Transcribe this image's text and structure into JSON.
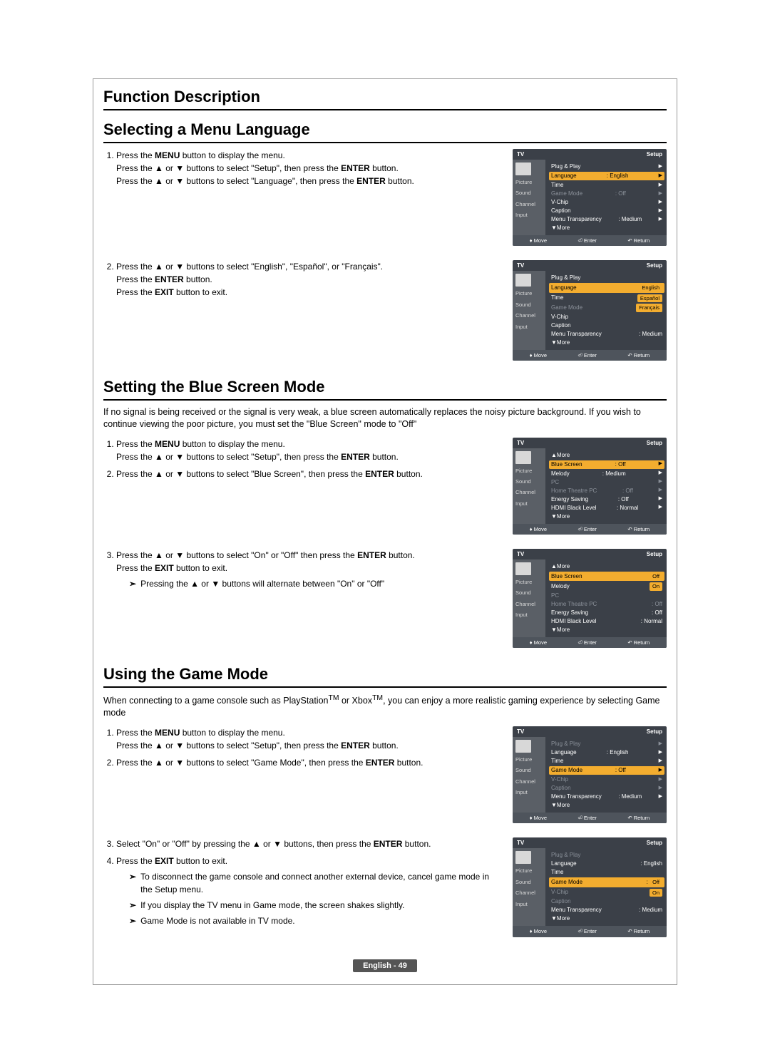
{
  "headings": {
    "function_desc": "Function Description",
    "select_lang": "Selecting a Menu Language",
    "blue_screen": "Setting the Blue Screen Mode",
    "game_mode": "Using the Game Mode"
  },
  "lang_section": {
    "step1_a": "Press the ",
    "step1_menu": "MENU",
    "step1_b": " button to display the menu.",
    "step1_c": "Press the ▲ or ▼ buttons to select \"Setup\", then press the ",
    "enter": "ENTER",
    "step1_d": " button.",
    "step1_e": "Press the ▲ or ▼ buttons to select \"Language\", then press the ",
    "step2_a": "Press the ▲ or ▼ buttons to select \"English\", \"Español\", or \"Français\".",
    "step2_b": "Press the ",
    "step2_c": " button.",
    "step2_d": "Press the ",
    "exit": "EXIT",
    "step2_e": " button to exit."
  },
  "blue_section": {
    "intro": "If no signal is being received or the signal is very weak, a blue screen automatically replaces the noisy picture background. If you wish to continue viewing the poor picture, you must set the \"Blue Screen\" mode to \"Off\"",
    "step1_a": "Press the ",
    "step1_b": " button to display the menu.",
    "step1_c": "Press the ▲ or ▼ buttons to select \"Setup\", then press the ",
    "step1_d": " button.",
    "step2": "Press the ▲ or ▼ buttons to select \"Blue Screen\", then press the ",
    "step3_a": "Press the ▲ or ▼ buttons to select \"On\" or \"Off\" then press the ",
    "step3_b": "Press the ",
    "step3_c": " button to exit.",
    "note": "Pressing the ▲ or ▼ buttons will alternate between \"On\" or \"Off\""
  },
  "game_section": {
    "intro_a": "When connecting to a game console such as PlayStation",
    "intro_b": " or Xbox",
    "intro_c": ", you can enjoy a more realistic gaming experience by selecting Game mode",
    "step1_a": "Press the ",
    "step1_b": " button to display the menu.",
    "step1_c": "Press the ▲ or ▼ buttons to select \"Setup\", then press the ",
    "step1_d": " button.",
    "step2": "Press the ▲ or ▼ buttons to select \"Game Mode\", then press the ",
    "step3": "Select \"On\" or \"Off\" by pressing the ▲ or ▼ buttons, then press the ",
    "step4_a": "Press the ",
    "step4_b": " button to exit.",
    "note1": "To disconnect the game console and connect another external device, cancel game mode in the Setup menu.",
    "note2": "If you display the TV menu in Game mode, the screen shakes slightly.",
    "note3": "Game Mode is not available in TV mode."
  },
  "tv": {
    "tv_label": "TV",
    "setup": "Setup",
    "picture": "Picture",
    "sound": "Sound",
    "channel": "Channel",
    "input": "Input",
    "plug_play": "Plug & Play",
    "language": "Language",
    "english": "English",
    "espanol": "Español",
    "francais": "Français",
    "time": "Time",
    "game_mode": "Game Mode",
    "off": "Off",
    "on": "On",
    "vchip": "V-Chip",
    "caption": "Caption",
    "menu_transparency": "Menu Transparency",
    "medium": "Medium",
    "more_down": "▼More",
    "more_up": "▲More",
    "blue_screen": "Blue Screen",
    "melody": "Melody",
    "pc": "PC",
    "home_theatre_pc": "Home Theatre PC",
    "energy_saving": "Energy Saving",
    "hdmi_black": "HDMI Black Level",
    "normal": "Normal",
    "foot_move": "Move",
    "foot_enter": "Enter",
    "foot_return": "Return"
  },
  "footer": "English - 49"
}
